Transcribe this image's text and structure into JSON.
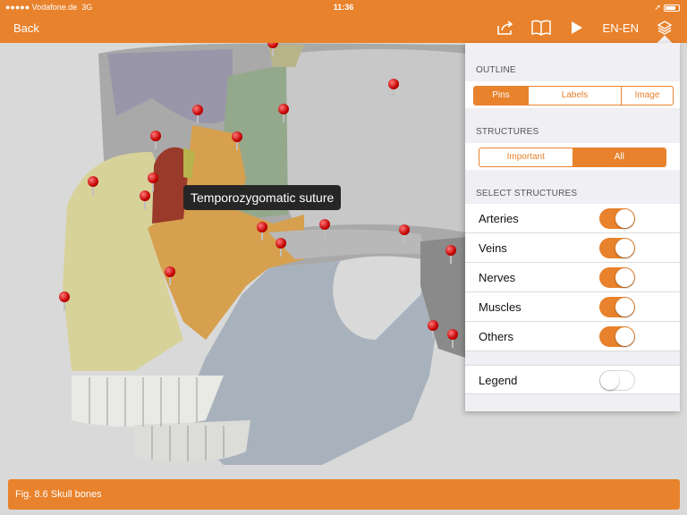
{
  "status": {
    "carrier": "●●●●● Vodafone.de",
    "network": "3G",
    "time": "11:36",
    "location_glyph": "➚"
  },
  "nav": {
    "back_label": "Back",
    "language": "EN-EN"
  },
  "tooltip": "Temporozygomatic suture",
  "caption": "Fig. 8.6 Skull bones",
  "panel": {
    "outline": {
      "title": "OUTLINE",
      "options": [
        "Pins",
        "Labels",
        "Image"
      ],
      "selected": "Pins"
    },
    "structures": {
      "title": "STRUCTURES",
      "options": [
        "Important",
        "All"
      ],
      "selected": "All"
    },
    "select": {
      "title": "SELECT STRUCTURES",
      "items": [
        {
          "label": "Arteries",
          "on": true
        },
        {
          "label": "Veins",
          "on": true
        },
        {
          "label": "Nerves",
          "on": true
        },
        {
          "label": "Muscles",
          "on": true
        },
        {
          "label": "Others",
          "on": true
        }
      ]
    },
    "legend": {
      "label": "Legend",
      "on": false
    }
  },
  "colors": {
    "accent": "#e8822c"
  }
}
